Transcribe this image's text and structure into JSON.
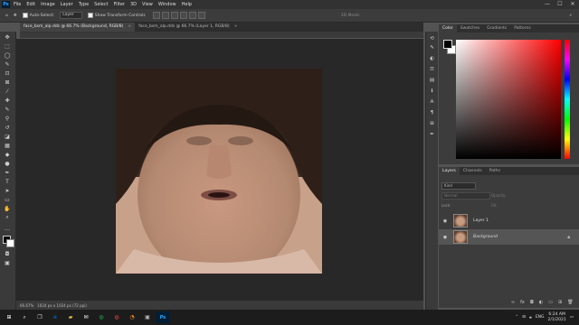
{
  "menu": {
    "logo": "Ps",
    "items": [
      "File",
      "Edit",
      "Image",
      "Layer",
      "Type",
      "Select",
      "Filter",
      "3D",
      "View",
      "Window",
      "Help"
    ]
  },
  "window_controls": {
    "minimize": "—",
    "maximize": "☐",
    "close": "✕"
  },
  "options_bar": {
    "auto_select_label": "Auto-Select:",
    "auto_select_value": "Layer",
    "transform_label": "Show Transform Controls",
    "mode_label": "3D Mode:"
  },
  "tabs": [
    {
      "label": "face_bsm_alp.dds @ 66.7% (Background, RGB/8)",
      "close": "×",
      "active": true
    },
    {
      "label": "face_bsm_alp.dds @ 66.7% (Layer 1, RGB/8)",
      "close": "×",
      "active": false
    }
  ],
  "status_bar": {
    "zoom": "66.67%",
    "doc_info": "1024 px x 1024 px (72 ppi)"
  },
  "color_panel": {
    "tabs": [
      "Color",
      "Swatches",
      "Gradients",
      "Patterns"
    ],
    "foreground": "#000000",
    "background": "#ffffff",
    "hue": "#ff0000"
  },
  "layers_panel": {
    "tabs": [
      "Layers",
      "Channels",
      "Paths"
    ],
    "search_placeholder": "Kind",
    "blend_mode": "Normal",
    "opacity_label": "Opacity:",
    "lock_label": "Lock:",
    "fill_label": "Fill:",
    "layers": [
      {
        "name": "Layer 1",
        "selected": false
      },
      {
        "name": "Background",
        "selected": true
      }
    ]
  },
  "taskbar": {
    "language": "ENG",
    "time": "6:24 AM",
    "date": "2/1/2021"
  }
}
